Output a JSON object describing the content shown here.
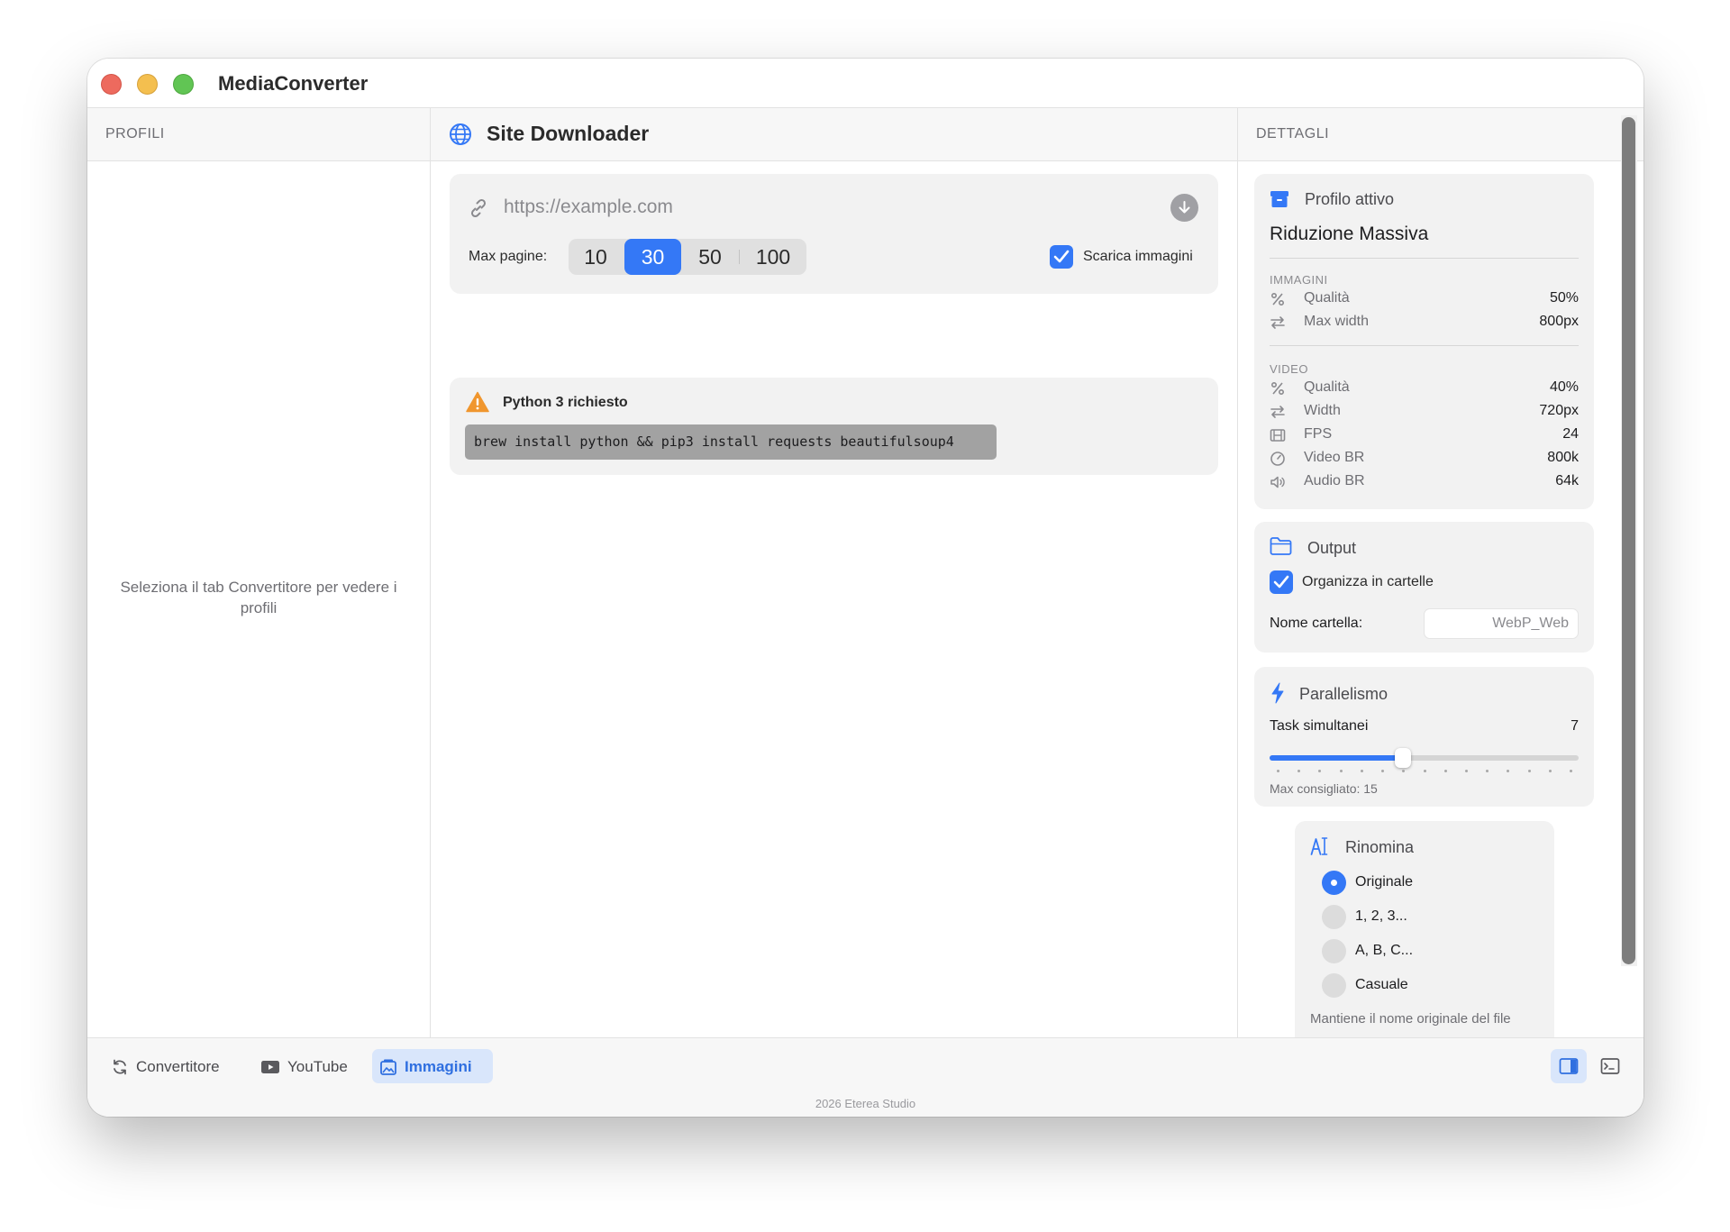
{
  "app": {
    "title": "MediaConverter"
  },
  "profiles": {
    "header": "PROFILI",
    "empty_message": "Seleziona il tab Convertitore per vedere i profili"
  },
  "main": {
    "title": "Site Downloader",
    "url_placeholder": "https://example.com",
    "max_pages_label": "Max pagine:",
    "max_pages_options": [
      "10",
      "30",
      "50",
      "100"
    ],
    "max_pages_selected": "30",
    "download_images_label": "Scarica immagini",
    "download_images_checked": true,
    "warning": {
      "title": "Python 3 richiesto",
      "command": "brew install python && pip3 install requests beautifulsoup4"
    }
  },
  "details": {
    "header": "DETTAGLI",
    "active_profile": {
      "title": "Profilo attivo",
      "name": "Riduzione Massiva",
      "images_label": "IMMAGINI",
      "images": [
        {
          "icon": "percent-icon",
          "name": "Qualità",
          "value": "50%"
        },
        {
          "icon": "resize-arrows-icon",
          "name": "Max width",
          "value": "800px"
        }
      ],
      "video_label": "VIDEO",
      "video": [
        {
          "icon": "percent-icon",
          "name": "Qualità",
          "value": "40%"
        },
        {
          "icon": "resize-arrows-icon",
          "name": "Width",
          "value": "720px"
        },
        {
          "icon": "film-icon",
          "name": "FPS",
          "value": "24"
        },
        {
          "icon": "gauge-icon",
          "name": "Video BR",
          "value": "800k"
        },
        {
          "icon": "speaker-icon",
          "name": "Audio BR",
          "value": "64k"
        }
      ]
    },
    "output": {
      "title": "Output",
      "organize_label": "Organizza in cartelle",
      "organize_checked": true,
      "folder_label": "Nome cartella:",
      "folder_value": "WebP_Web"
    },
    "parallel": {
      "title": "Parallelismo",
      "tasks_label": "Task simultanei",
      "tasks_value": "7",
      "slider_min": 1,
      "slider_max": 15,
      "slider_value": 7,
      "hint": "Max consigliato: 15"
    },
    "rename": {
      "title": "Rinomina",
      "options": [
        "Originale",
        "1, 2, 3...",
        "A, B, C...",
        "Casuale"
      ],
      "selected": "Originale",
      "hint": "Mantiene il nome originale del file"
    }
  },
  "bottombar": {
    "tabs": [
      {
        "label": "Convertitore",
        "icon": "refresh-icon"
      },
      {
        "label": "YouTube",
        "icon": "youtube-icon"
      },
      {
        "label": "Immagini",
        "icon": "images-icon"
      }
    ],
    "active_tab": "Immagini"
  },
  "footer": {
    "text": "2026 Eterea Studio"
  },
  "colors": {
    "accent": "#3478f6",
    "warning": "#f0962e"
  }
}
